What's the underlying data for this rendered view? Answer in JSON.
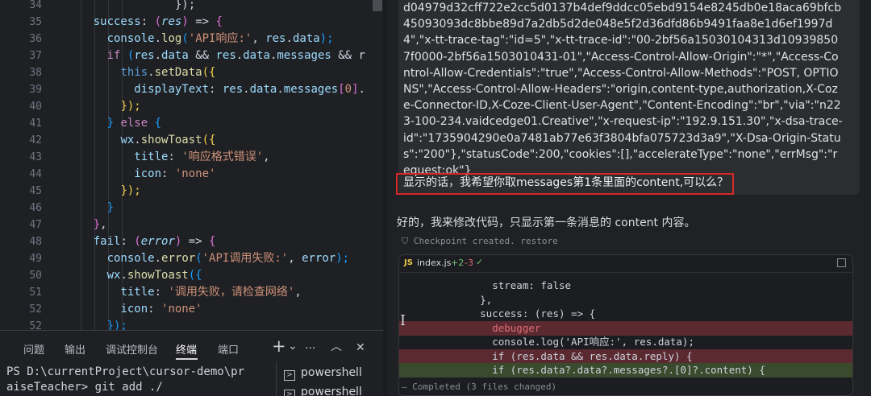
{
  "editor": {
    "lines": [
      {
        "n": "34",
        "indent": 0,
        "tokens": [
          {
            "t": "                });",
            "c": "op"
          }
        ]
      },
      {
        "n": "35",
        "tokens": [
          {
            "t": "    ",
            "c": "op"
          },
          {
            "t": "success",
            "c": "prop"
          },
          {
            "t": ": ",
            "c": "op"
          },
          {
            "t": "(",
            "c": "par2"
          },
          {
            "t": "res",
            "c": "arg"
          },
          {
            "t": ")",
            "c": "par2"
          },
          {
            "t": " => ",
            "c": "op"
          },
          {
            "t": "{",
            "c": "par2"
          }
        ]
      },
      {
        "n": "36",
        "tokens": [
          {
            "t": "      ",
            "c": "op"
          },
          {
            "t": "console",
            "c": "var"
          },
          {
            "t": ".",
            "c": "op"
          },
          {
            "t": "log",
            "c": "func"
          },
          {
            "t": "(",
            "c": "par3"
          },
          {
            "t": "'API响应:'",
            "c": "str"
          },
          {
            "t": ", ",
            "c": "op"
          },
          {
            "t": "res",
            "c": "var"
          },
          {
            "t": ".",
            "c": "op"
          },
          {
            "t": "data",
            "c": "var"
          },
          {
            "t": ");",
            "c": "par3"
          }
        ]
      },
      {
        "n": "37",
        "tokens": [
          {
            "t": "      ",
            "c": "op"
          },
          {
            "t": "if",
            "c": "kw"
          },
          {
            "t": " ",
            "c": "op"
          },
          {
            "t": "(",
            "c": "par3"
          },
          {
            "t": "res",
            "c": "var"
          },
          {
            "t": ".",
            "c": "op"
          },
          {
            "t": "data",
            "c": "var"
          },
          {
            "t": " && ",
            "c": "op"
          },
          {
            "t": "res",
            "c": "var"
          },
          {
            "t": ".",
            "c": "op"
          },
          {
            "t": "data",
            "c": "var"
          },
          {
            "t": ".",
            "c": "op"
          },
          {
            "t": "messages",
            "c": "var"
          },
          {
            "t": " && r",
            "c": "op"
          }
        ]
      },
      {
        "n": "38",
        "tokens": [
          {
            "t": "        ",
            "c": "op"
          },
          {
            "t": "this",
            "c": "this"
          },
          {
            "t": ".",
            "c": "op"
          },
          {
            "t": "setData",
            "c": "func"
          },
          {
            "t": "({",
            "c": "par"
          }
        ]
      },
      {
        "n": "39",
        "tokens": [
          {
            "t": "          ",
            "c": "op"
          },
          {
            "t": "displayText",
            "c": "var"
          },
          {
            "t": ": ",
            "c": "op"
          },
          {
            "t": "res",
            "c": "var"
          },
          {
            "t": ".",
            "c": "op"
          },
          {
            "t": "data",
            "c": "var"
          },
          {
            "t": ".",
            "c": "op"
          },
          {
            "t": "messages",
            "c": "var"
          },
          {
            "t": "[",
            "c": "par2"
          },
          {
            "t": "0",
            "c": "str"
          },
          {
            "t": "]",
            "c": "par2"
          },
          {
            "t": ".",
            "c": "op"
          }
        ]
      },
      {
        "n": "40",
        "tokens": [
          {
            "t": "        ",
            "c": "op"
          },
          {
            "t": "});",
            "c": "par"
          }
        ]
      },
      {
        "n": "41",
        "tokens": [
          {
            "t": "      ",
            "c": "op"
          },
          {
            "t": "}",
            "c": "par3"
          },
          {
            "t": " ",
            "c": "op"
          },
          {
            "t": "else",
            "c": "kw"
          },
          {
            "t": " ",
            "c": "op"
          },
          {
            "t": "{",
            "c": "par3"
          }
        ]
      },
      {
        "n": "42",
        "tokens": [
          {
            "t": "        ",
            "c": "op"
          },
          {
            "t": "wx",
            "c": "var"
          },
          {
            "t": ".",
            "c": "op"
          },
          {
            "t": "showToast",
            "c": "func"
          },
          {
            "t": "({",
            "c": "par"
          }
        ]
      },
      {
        "n": "43",
        "tokens": [
          {
            "t": "          ",
            "c": "op"
          },
          {
            "t": "title",
            "c": "var"
          },
          {
            "t": ": ",
            "c": "op"
          },
          {
            "t": "'响应格式错误'",
            "c": "str"
          },
          {
            "t": ",",
            "c": "op"
          }
        ]
      },
      {
        "n": "44",
        "tokens": [
          {
            "t": "          ",
            "c": "op"
          },
          {
            "t": "icon",
            "c": "var"
          },
          {
            "t": ": ",
            "c": "op"
          },
          {
            "t": "'none'",
            "c": "str"
          }
        ]
      },
      {
        "n": "45",
        "tokens": [
          {
            "t": "        ",
            "c": "op"
          },
          {
            "t": "});",
            "c": "par"
          }
        ]
      },
      {
        "n": "46",
        "tokens": [
          {
            "t": "      ",
            "c": "op"
          },
          {
            "t": "}",
            "c": "par3"
          }
        ]
      },
      {
        "n": "47",
        "tokens": [
          {
            "t": "    ",
            "c": "op"
          },
          {
            "t": "}",
            "c": "par2"
          },
          {
            "t": ",",
            "c": "op"
          }
        ]
      },
      {
        "n": "48",
        "tokens": [
          {
            "t": "    ",
            "c": "op"
          },
          {
            "t": "fail",
            "c": "prop"
          },
          {
            "t": ": ",
            "c": "op"
          },
          {
            "t": "(",
            "c": "par2"
          },
          {
            "t": "error",
            "c": "arg"
          },
          {
            "t": ")",
            "c": "par2"
          },
          {
            "t": " => ",
            "c": "op"
          },
          {
            "t": "{",
            "c": "par2"
          }
        ]
      },
      {
        "n": "49",
        "tokens": [
          {
            "t": "      ",
            "c": "op"
          },
          {
            "t": "console",
            "c": "var"
          },
          {
            "t": ".",
            "c": "op"
          },
          {
            "t": "error",
            "c": "func"
          },
          {
            "t": "(",
            "c": "par3"
          },
          {
            "t": "'API调用失败:'",
            "c": "str"
          },
          {
            "t": ", ",
            "c": "op"
          },
          {
            "t": "error",
            "c": "var"
          },
          {
            "t": ");",
            "c": "par3"
          }
        ]
      },
      {
        "n": "50",
        "tokens": [
          {
            "t": "      ",
            "c": "op"
          },
          {
            "t": "wx",
            "c": "var"
          },
          {
            "t": ".",
            "c": "op"
          },
          {
            "t": "showToast",
            "c": "func"
          },
          {
            "t": "({",
            "c": "par3"
          }
        ]
      },
      {
        "n": "51",
        "tokens": [
          {
            "t": "        ",
            "c": "op"
          },
          {
            "t": "title",
            "c": "var"
          },
          {
            "t": ": ",
            "c": "op"
          },
          {
            "t": "'调用失败，请检查网络'",
            "c": "str"
          },
          {
            "t": ",",
            "c": "op"
          }
        ]
      },
      {
        "n": "52",
        "tokens": [
          {
            "t": "        ",
            "c": "op"
          },
          {
            "t": "icon",
            "c": "var"
          },
          {
            "t": ": ",
            "c": "op"
          },
          {
            "t": "'none'",
            "c": "str"
          }
        ]
      },
      {
        "n": "52",
        "tokens": [
          {
            "t": "      ",
            "c": "op"
          },
          {
            "t": "});",
            "c": "par3"
          }
        ]
      }
    ]
  },
  "terminal": {
    "tabs": [
      "问题",
      "输出",
      "调试控制台",
      "终端",
      "端口"
    ],
    "active_tab": "终端",
    "plus_icon": "+",
    "chevron_down_icon": "⌄",
    "more_icon": "···",
    "chevron_up_icon": "︿",
    "close_icon": "✕",
    "line1": "PS D:\\currentProject\\cursor-demo\\pr",
    "line2": "aiseTeacher> git add ./",
    "shells": [
      "powershell",
      "powershell"
    ]
  },
  "chat": {
    "response_text": "d04979d32cff722e2cc5d0137b4def9ddcc05ebd9154e8245db0e18aca69bfcb45093093dc8bbe89d7a2db5d2de048e5f2d36dfd86b9491faa8e1d6ef1997d4\",\"x-tt-trace-tag\":\"id=5\",\"x-tt-trace-id\":\"00-2bf56a15030104313d109398507f0000-2bf56a1503010431-01\",\"Access-Control-Allow-Origin\":\"*\",\"Access-Control-Allow-Credentials\":\"true\",\"Access-Control-Allow-Methods\":\"POST, OPTIONS\",\"Access-Control-Allow-Headers\":\"origin,content-type,authorization,X-Coze-Connector-ID,X-Coze-Client-User-Agent\",\"Content-Encoding\":\"br\",\"via\":\"n223-100-234.vaidcedge01.Creative\",\"x-request-ip\":\"192.9.151.30\",\"x-dsa-trace-id\":\"1735904290e0a7481ab77e63f3804bfa075723d3a9\",\"X-Dsa-Origin-Status\":\"200\"},\"statusCode\":200,\"cookies\":[],\"accelerateType\":\"none\",\"errMsg\":\"request:ok\"}",
    "question": "显示的话，我希望你取messages第1条里面的content,可以么？",
    "answer": "好的，我来修改代码，只显示第一条消息的 content 内容。",
    "checkpoint_label": "Checkpoint created.",
    "checkpoint_restore": "restore",
    "diff": {
      "lang_badge": "JS",
      "filename": "index.js",
      "plus": "+2",
      "minus": "-3",
      "check": "✓",
      "lines": [
        {
          "kind": "ctx",
          "text": "        stream: false"
        },
        {
          "kind": "ctx",
          "text": "      },"
        },
        {
          "kind": "ctx",
          "text": "      success: (res) => {"
        },
        {
          "kind": "del",
          "text": "        debugger"
        },
        {
          "kind": "ctx",
          "text": "        console.log('API响应:', res.data);"
        },
        {
          "kind": "del",
          "text": "        if (res.data && res.data.reply) {"
        },
        {
          "kind": "add",
          "text": "        if (res.data?.data?.messages?.[0]?.content) {"
        }
      ]
    },
    "completed_label": "Completed",
    "completed_sub": "(3 files changed)"
  },
  "colors": {
    "accent_red": "#d62828",
    "diff_del": "#5b2a30",
    "diff_add": "#3a4a2c"
  }
}
